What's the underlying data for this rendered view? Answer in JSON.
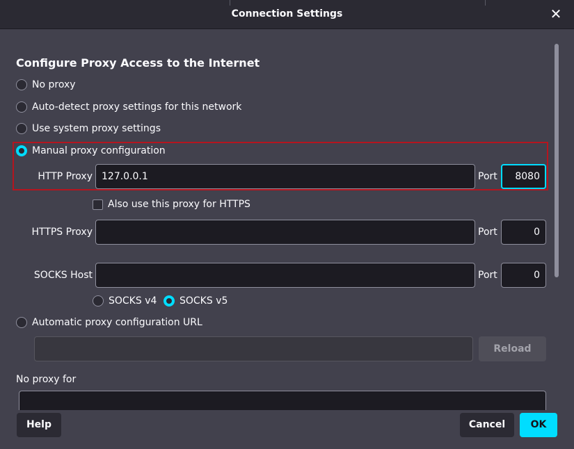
{
  "window": {
    "title": "Connection Settings"
  },
  "section": {
    "heading": "Configure Proxy Access to the Internet"
  },
  "proxy_options": {
    "no_proxy": "No proxy",
    "auto_detect": "Auto-detect proxy settings for this network",
    "system": "Use system proxy settings",
    "manual": "Manual proxy configuration",
    "auto_url": "Automatic proxy configuration URL",
    "selected": "manual"
  },
  "http_proxy": {
    "label": "HTTP Proxy",
    "value": "127.0.0.1",
    "port_label": "Port",
    "port": "8080"
  },
  "also_https": {
    "label": "Also use this proxy for HTTPS",
    "checked": false
  },
  "https_proxy": {
    "label": "HTTPS Proxy",
    "value": "",
    "port_label": "Port",
    "port": "0"
  },
  "socks": {
    "label": "SOCKS Host",
    "value": "",
    "port_label": "Port",
    "port": "0",
    "v4": "SOCKS v4",
    "v5": "SOCKS v5",
    "selected": "v5"
  },
  "auto_url": {
    "value": "",
    "reload_label": "Reload"
  },
  "no_proxy_for": {
    "label": "No proxy for",
    "value": ""
  },
  "footer": {
    "help": "Help",
    "cancel": "Cancel",
    "ok": "OK"
  },
  "colors": {
    "accent": "#00ddff",
    "highlight_border": "#b5151f",
    "background": "#42414d",
    "field": "#1c1b22"
  }
}
